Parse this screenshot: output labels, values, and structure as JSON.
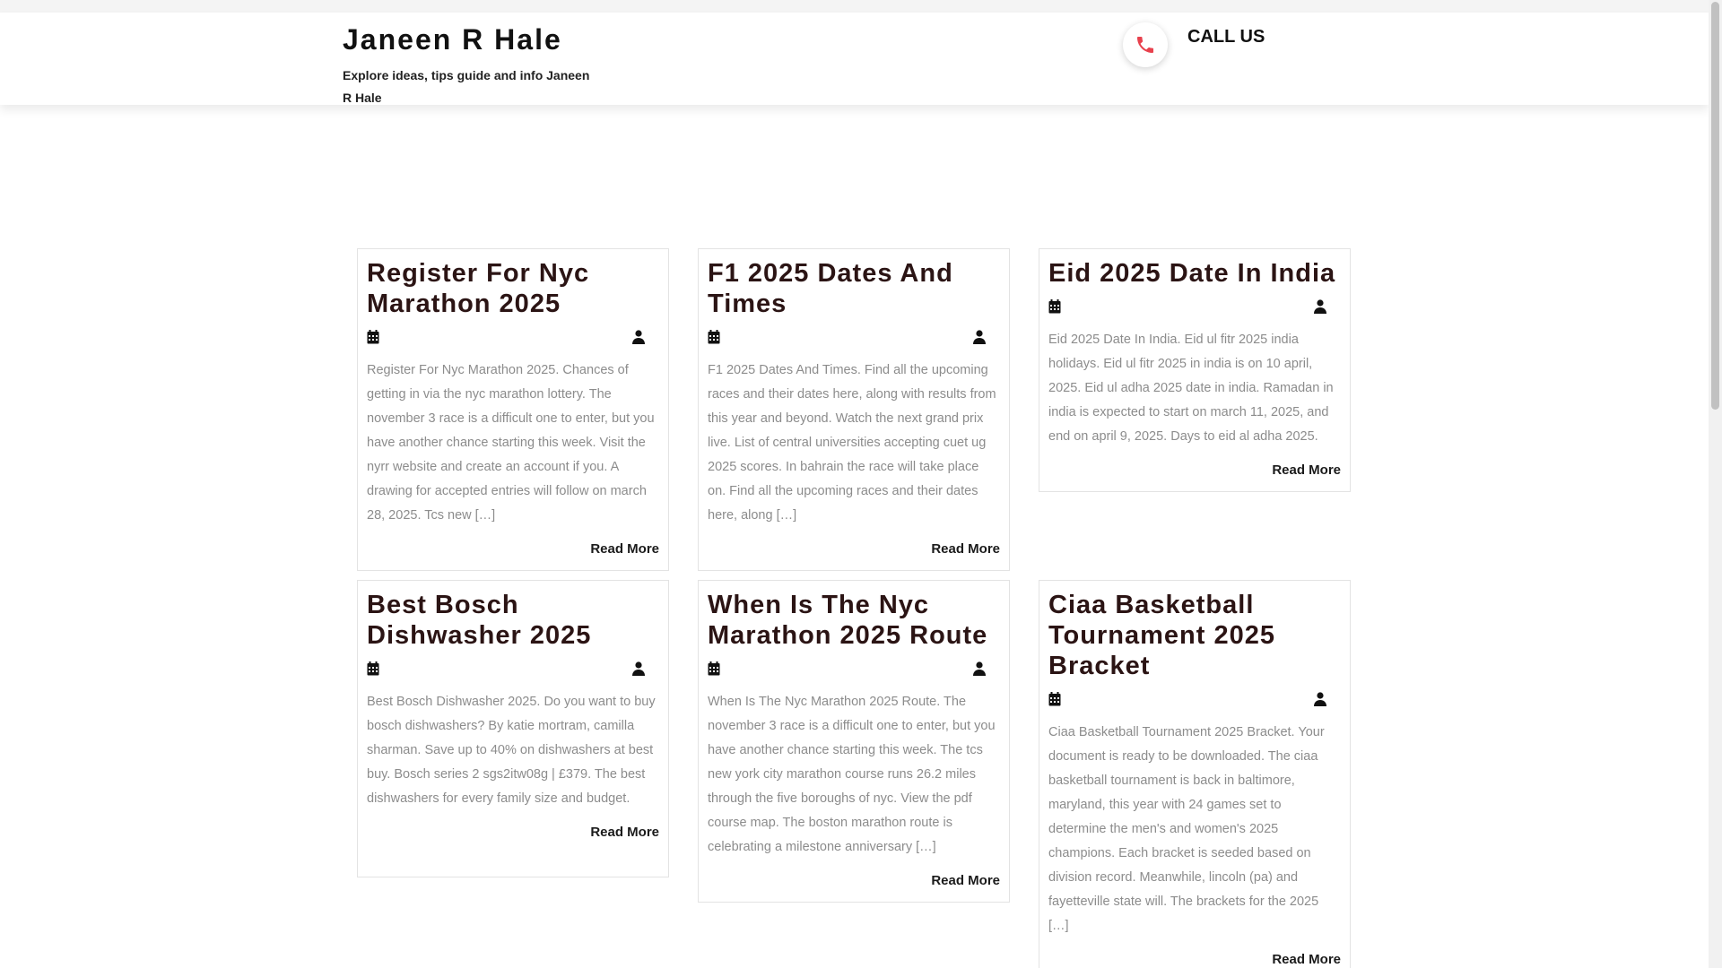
{
  "header": {
    "site_title": "Janeen R Hale",
    "tagline": "Explore ideas, tips guide and info Janeen R Hale",
    "call_label": "CALL US"
  },
  "colors": {
    "accent": "#e8414d",
    "title": "#2b1414",
    "excerpt": "#8c8c8c"
  },
  "icons": {
    "phone": "phone-icon",
    "date": "calendar-icon",
    "author": "user-icon"
  },
  "posts": [
    {
      "title": "Register For Nyc Marathon 2025",
      "excerpt": "Register For Nyc Marathon 2025. Chances of getting in via the nyc marathon lottery. The november 3 race is a difficult one to enter, but you have another chance starting this week. Visit the nyrr website and create an account if you. A drawing for accepted entries will follow on march 28, 2025. Tcs new […]",
      "read_more": "Read More"
    },
    {
      "title": "F1 2025 Dates And Times",
      "excerpt": "F1 2025 Dates And Times. Find all the upcoming races and their dates here, along with results from this year and beyond. Watch the next grand prix live. List of central universities accepting cuet ug 2025 scores. In bahrain the race will take place on. Find all the upcoming races and their dates here, along […]",
      "read_more": "Read More"
    },
    {
      "title": "Eid 2025 Date In India",
      "excerpt": "Eid 2025 Date In India. Eid ul fitr 2025 india holidays. Eid ul fitr 2025 in india is on 10 april, 2025. Eid ul adha 2025 date in india. Ramadan in india is expected to start on march 11, 2025, and end on april 9, 2025. Days to eid al adha 2025.",
      "read_more": "Read More"
    },
    {
      "title": "Best Bosch Dishwasher 2025",
      "excerpt": "Best Bosch Dishwasher 2025. Do you want to buy bosch dishwashers? By katie mortram, camilla sharman. Save up to 40% on dishwashers at best buy. Bosch series 2 sgs2itw08g | £379. The best dishwashers for every family size and budget.",
      "read_more": "Read More"
    },
    {
      "title": "When Is The Nyc Marathon 2025 Route",
      "excerpt": "When Is The Nyc Marathon 2025 Route. The november 3 race is a difficult one to enter, but you have another chance starting this week. The tcs new york city marathon course runs 26.2 miles through the five boroughs of nyc. View the pdf course map. The boston marathon route is celebrating a milestone anniversary […]",
      "read_more": "Read More"
    },
    {
      "title": "Ciaa Basketball Tournament 2025 Bracket",
      "excerpt": "Ciaa Basketball Tournament 2025 Bracket. Your document is ready to be downloaded. The ciaa basketball tournament is back in baltimore, maryland, this year with 24 games set to determine the men's and women's 2025 champions. Each bracket is seeded based on division record. Meanwhile, lincoln (pa) and fayetteville state will. The brackets for the 2025 […]",
      "read_more": "Read More"
    }
  ]
}
